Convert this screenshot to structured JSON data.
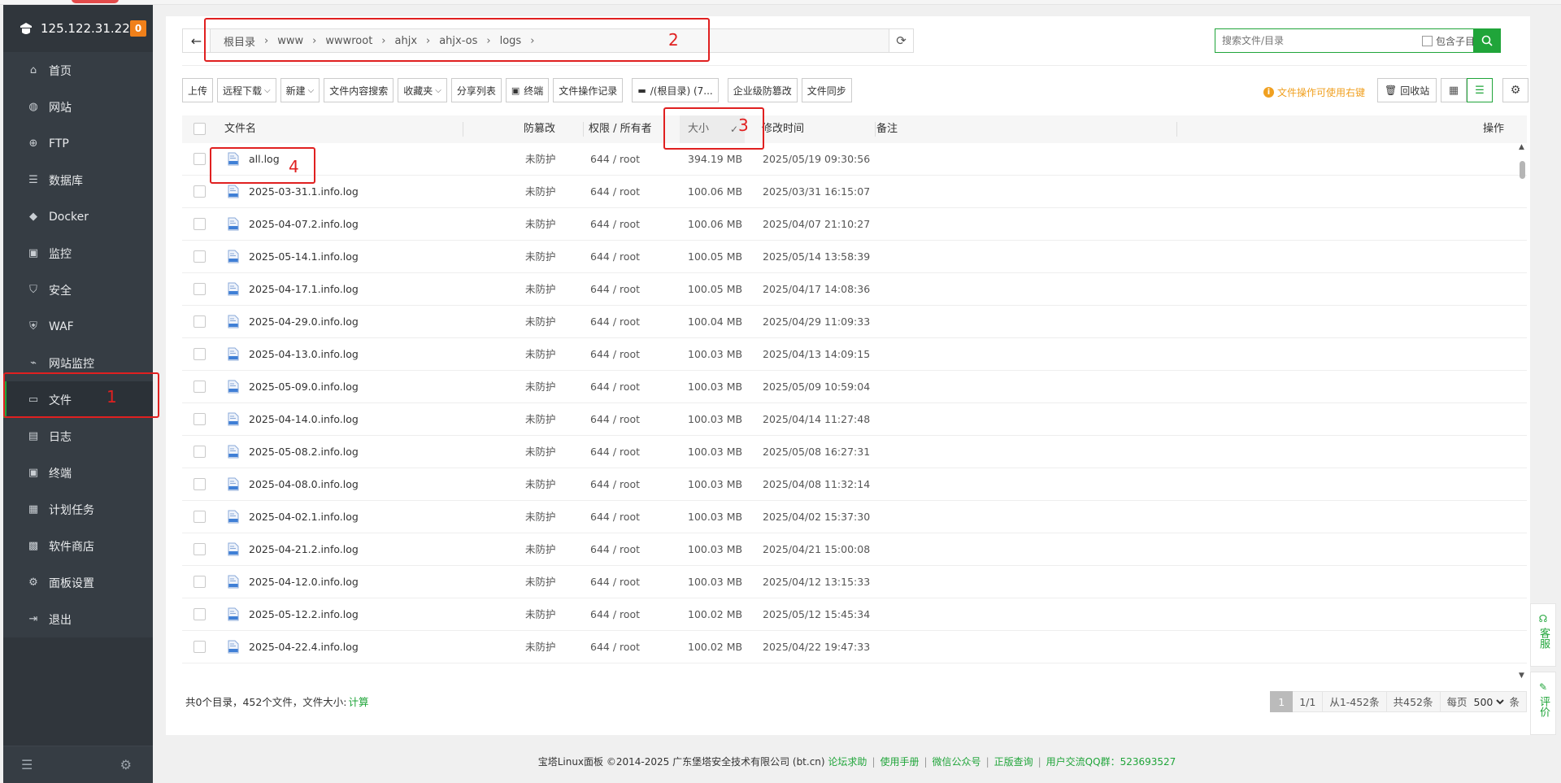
{
  "sidebar": {
    "server_ip": "125.122.31.22",
    "notice_count": "0",
    "items": [
      {
        "label": "首页",
        "icon": "home-icon"
      },
      {
        "label": "网站",
        "icon": "globe-icon"
      },
      {
        "label": "FTP",
        "icon": "ftp-icon"
      },
      {
        "label": "数据库",
        "icon": "database-icon"
      },
      {
        "label": "Docker",
        "icon": "docker-icon"
      },
      {
        "label": "监控",
        "icon": "monitor-icon"
      },
      {
        "label": "安全",
        "icon": "shield-icon"
      },
      {
        "label": "WAF",
        "icon": "waf-icon"
      },
      {
        "label": "网站监控",
        "icon": "site-monitor-icon"
      },
      {
        "label": "文件",
        "icon": "folder-icon"
      },
      {
        "label": "日志",
        "icon": "log-icon"
      },
      {
        "label": "终端",
        "icon": "terminal-icon"
      },
      {
        "label": "计划任务",
        "icon": "calendar-icon"
      },
      {
        "label": "软件商店",
        "icon": "apps-icon"
      },
      {
        "label": "面板设置",
        "icon": "gear-icon"
      },
      {
        "label": "退出",
        "icon": "logout-icon"
      }
    ],
    "active_item": "文件"
  },
  "path": {
    "crumbs": [
      "根目录",
      "www",
      "wwwroot",
      "ahjx",
      "ahjx-os",
      "logs"
    ]
  },
  "search": {
    "placeholder": "搜索文件/目录",
    "include_subdirs_label": "包含子目录"
  },
  "toolbar": {
    "upload": "上传",
    "remote_download": "远程下载",
    "new": "新建",
    "content_search": "文件内容搜索",
    "favorites": "收藏夹",
    "share_list": "分享列表",
    "terminal": "终端",
    "op_log": "文件操作记录",
    "disk": "/(根目录) (7...",
    "tamper_proof": "企业级防篡改",
    "file_sync": "文件同步",
    "tip": "文件操作可使用右键",
    "recycle": "回收站"
  },
  "table": {
    "headers": {
      "name": "文件名",
      "tamper": "防篡改",
      "perm": "权限 / 所有者",
      "size": "大小",
      "mtime": "修改时间",
      "remark": "备注",
      "ops": "操作"
    },
    "rows": [
      {
        "name": "all.log",
        "tamper": "未防护",
        "perm": "644 / root",
        "size": "394.19 MB",
        "mtime": "2025/05/19 09:30:56"
      },
      {
        "name": "2025-03-31.1.info.log",
        "tamper": "未防护",
        "perm": "644 / root",
        "size": "100.06 MB",
        "mtime": "2025/03/31 16:15:07"
      },
      {
        "name": "2025-04-07.2.info.log",
        "tamper": "未防护",
        "perm": "644 / root",
        "size": "100.06 MB",
        "mtime": "2025/04/07 21:10:27"
      },
      {
        "name": "2025-05-14.1.info.log",
        "tamper": "未防护",
        "perm": "644 / root",
        "size": "100.05 MB",
        "mtime": "2025/05/14 13:58:39"
      },
      {
        "name": "2025-04-17.1.info.log",
        "tamper": "未防护",
        "perm": "644 / root",
        "size": "100.05 MB",
        "mtime": "2025/04/17 14:08:36"
      },
      {
        "name": "2025-04-29.0.info.log",
        "tamper": "未防护",
        "perm": "644 / root",
        "size": "100.04 MB",
        "mtime": "2025/04/29 11:09:33"
      },
      {
        "name": "2025-04-13.0.info.log",
        "tamper": "未防护",
        "perm": "644 / root",
        "size": "100.03 MB",
        "mtime": "2025/04/13 14:09:15"
      },
      {
        "name": "2025-05-09.0.info.log",
        "tamper": "未防护",
        "perm": "644 / root",
        "size": "100.03 MB",
        "mtime": "2025/05/09 10:59:04"
      },
      {
        "name": "2025-04-14.0.info.log",
        "tamper": "未防护",
        "perm": "644 / root",
        "size": "100.03 MB",
        "mtime": "2025/04/14 11:27:48"
      },
      {
        "name": "2025-05-08.2.info.log",
        "tamper": "未防护",
        "perm": "644 / root",
        "size": "100.03 MB",
        "mtime": "2025/05/08 16:27:31"
      },
      {
        "name": "2025-04-08.0.info.log",
        "tamper": "未防护",
        "perm": "644 / root",
        "size": "100.03 MB",
        "mtime": "2025/04/08 11:32:14"
      },
      {
        "name": "2025-04-02.1.info.log",
        "tamper": "未防护",
        "perm": "644 / root",
        "size": "100.03 MB",
        "mtime": "2025/04/02 15:37:30"
      },
      {
        "name": "2025-04-21.2.info.log",
        "tamper": "未防护",
        "perm": "644 / root",
        "size": "100.03 MB",
        "mtime": "2025/04/21 15:00:08"
      },
      {
        "name": "2025-04-12.0.info.log",
        "tamper": "未防护",
        "perm": "644 / root",
        "size": "100.03 MB",
        "mtime": "2025/04/12 13:15:33"
      },
      {
        "name": "2025-05-12.2.info.log",
        "tamper": "未防护",
        "perm": "644 / root",
        "size": "100.02 MB",
        "mtime": "2025/05/12 15:45:34"
      },
      {
        "name": "2025-04-22.4.info.log",
        "tamper": "未防护",
        "perm": "644 / root",
        "size": "100.02 MB",
        "mtime": "2025/04/22 19:47:33"
      }
    ]
  },
  "footer": {
    "summary": "共0个目录，452个文件，文件大小:",
    "calc": "计算",
    "page_current": "1",
    "page_total": "1/1",
    "range": "从1-452条",
    "total": "共452条",
    "per_page_label": "每页",
    "per_page_value": "500",
    "per_page_unit": "条"
  },
  "copyright": {
    "text": "宝塔Linux面板 ©2014-2025 广东堡塔安全技术有限公司 (bt.cn)",
    "links": [
      "论坛求助",
      "使用手册",
      "微信公众号",
      "正版查询",
      "用户交流QQ群：523693527"
    ]
  },
  "side_tabs": [
    "客服",
    "评价"
  ],
  "annotations": [
    "1",
    "2",
    "3",
    "4"
  ],
  "colors": {
    "accent": "#20a53a",
    "sidebar_bg": "#363d44",
    "annotation": "#e02020",
    "warning": "#f0a020"
  }
}
